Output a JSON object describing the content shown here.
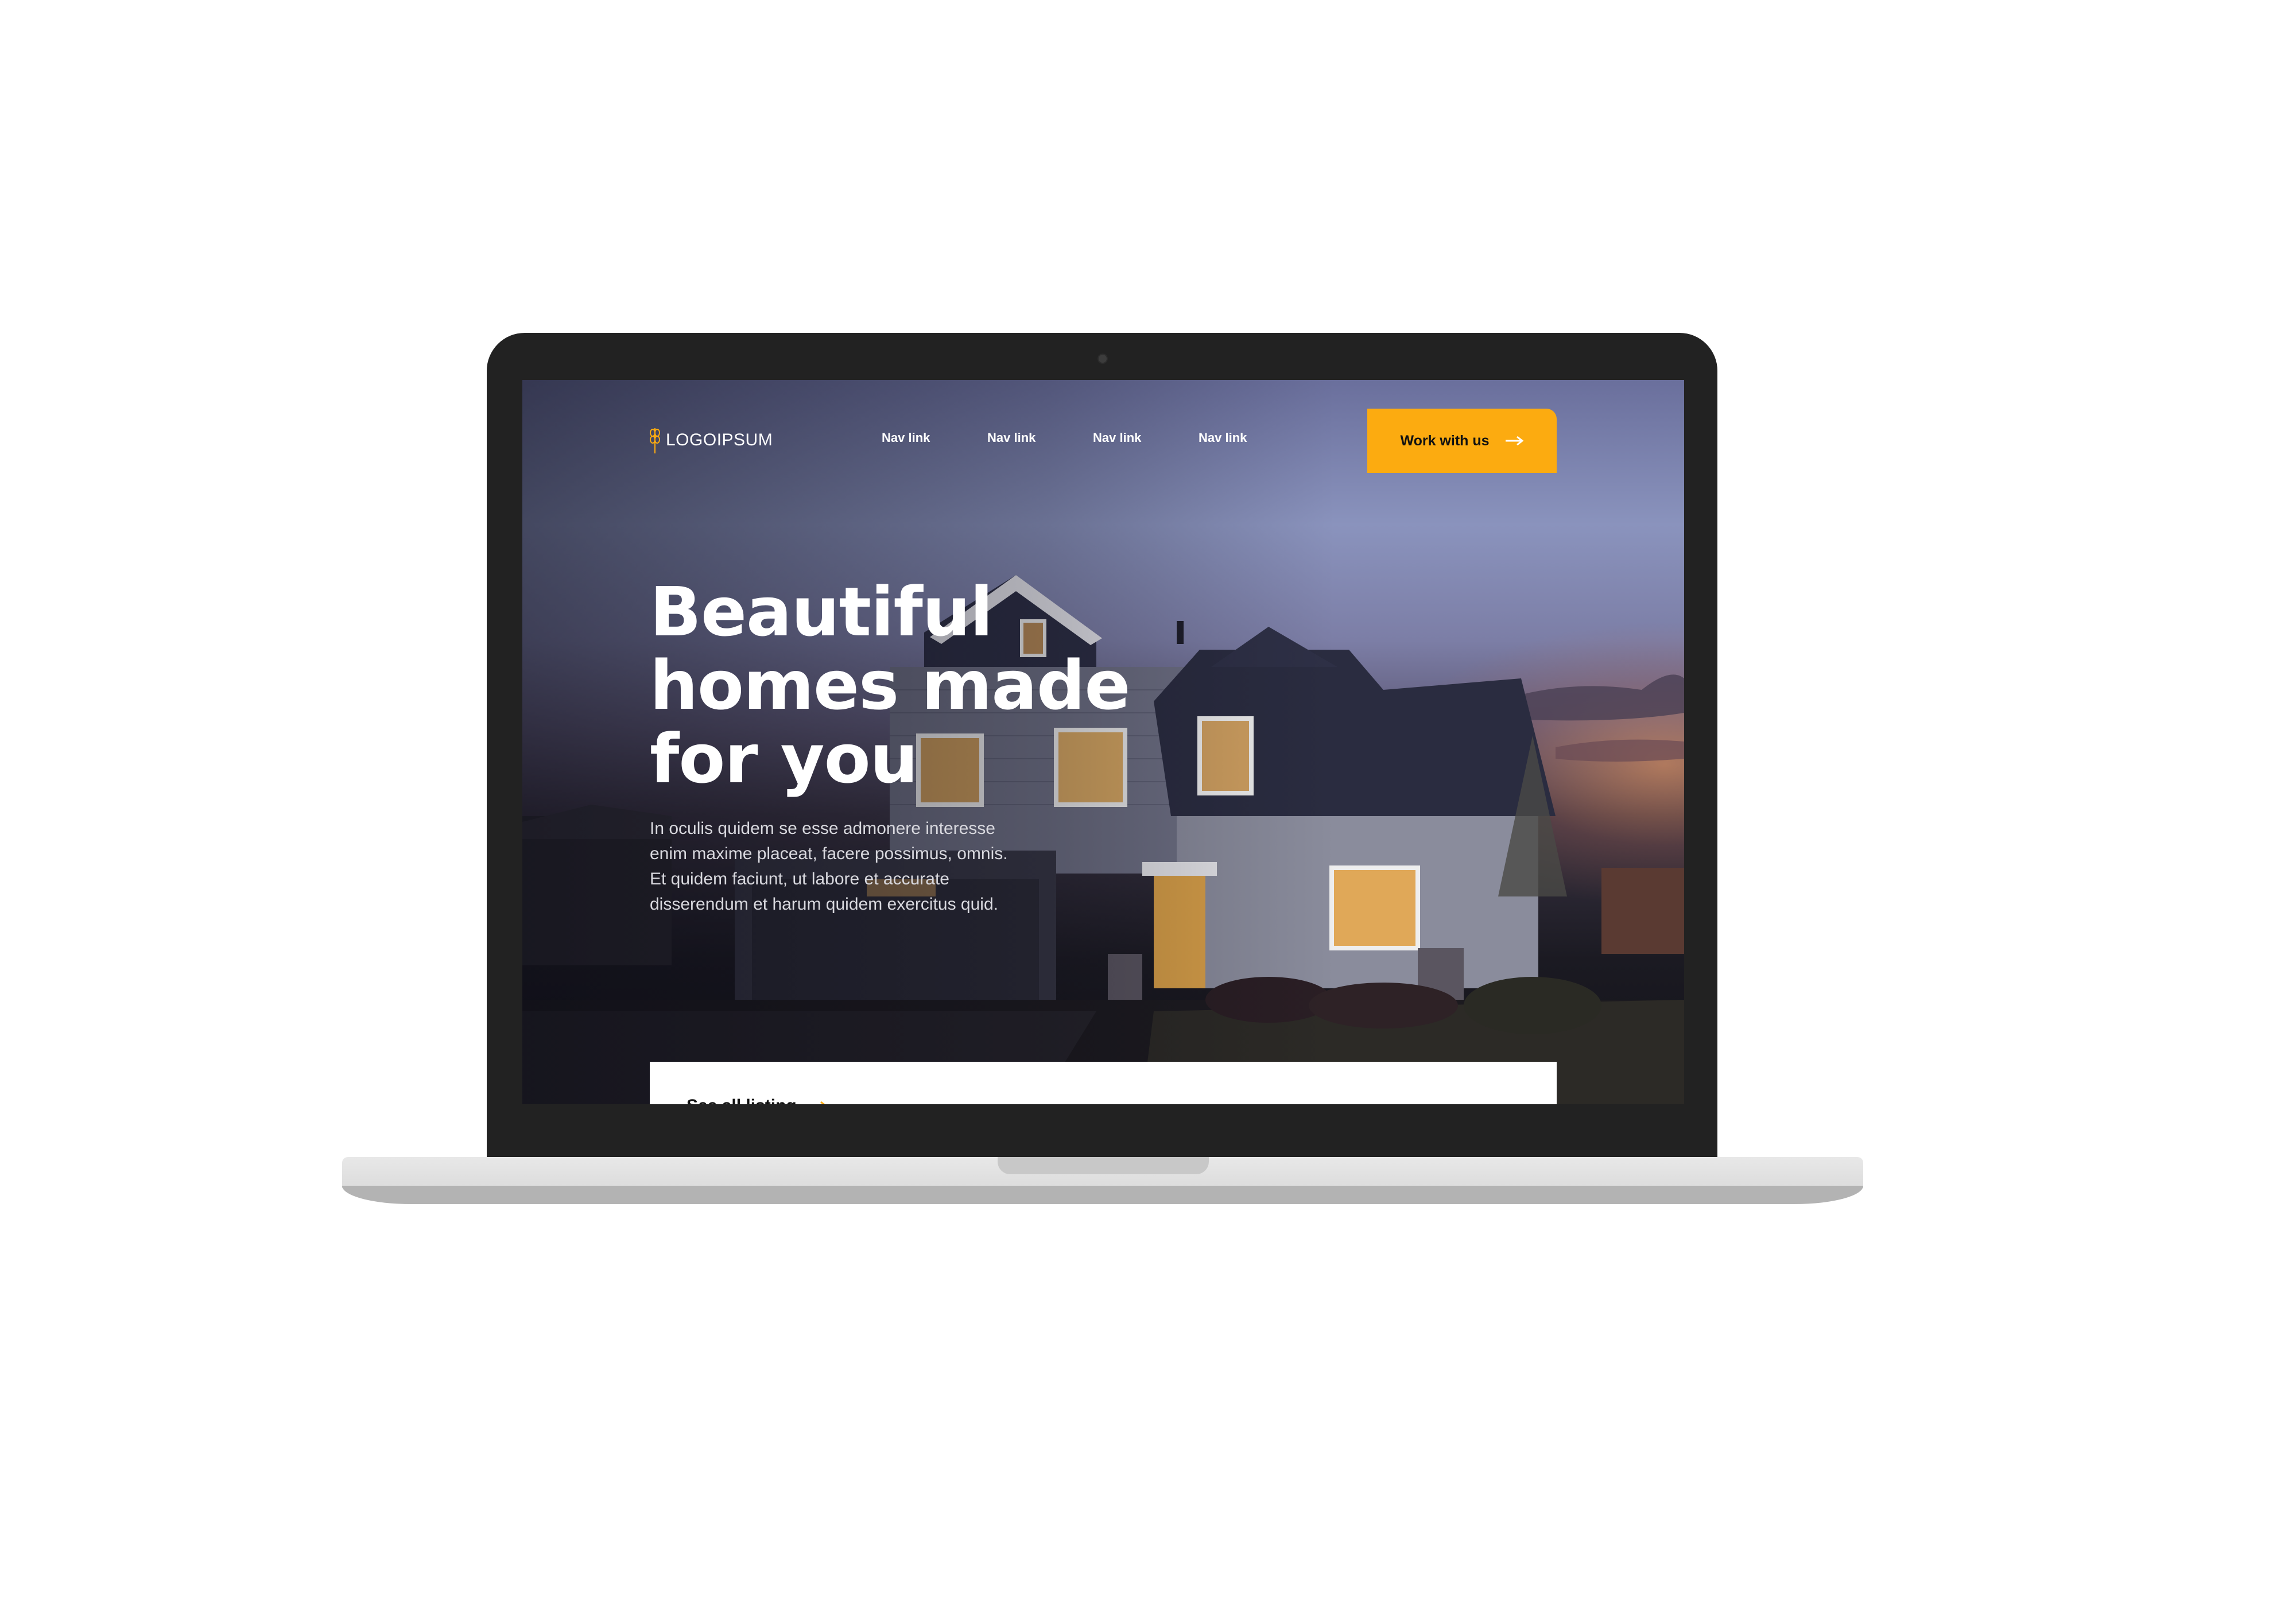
{
  "brand": {
    "logo_text": "LOGOIPSUM",
    "logo_icon": "wheat-icon",
    "accent_color": "#fcab10"
  },
  "nav": {
    "links": [
      "Nav link",
      "Nav link",
      "Nav link",
      "Nav link"
    ],
    "cta_label": "Work with us",
    "cta_icon": "arrow-right-icon"
  },
  "hero": {
    "title_lines": [
      "Beautiful",
      "homes made",
      "for you"
    ],
    "body_lines": [
      "In oculis quidem se esse admonere interesse",
      "enim maxime placeat, facere possimus, omnis.",
      "Et quidem faciunt, ut labore et accurate",
      "disserendum et harum quidem exercitus quid."
    ]
  },
  "listing": {
    "link_label": "See all listing",
    "link_icon": "arrow-right-icon"
  }
}
